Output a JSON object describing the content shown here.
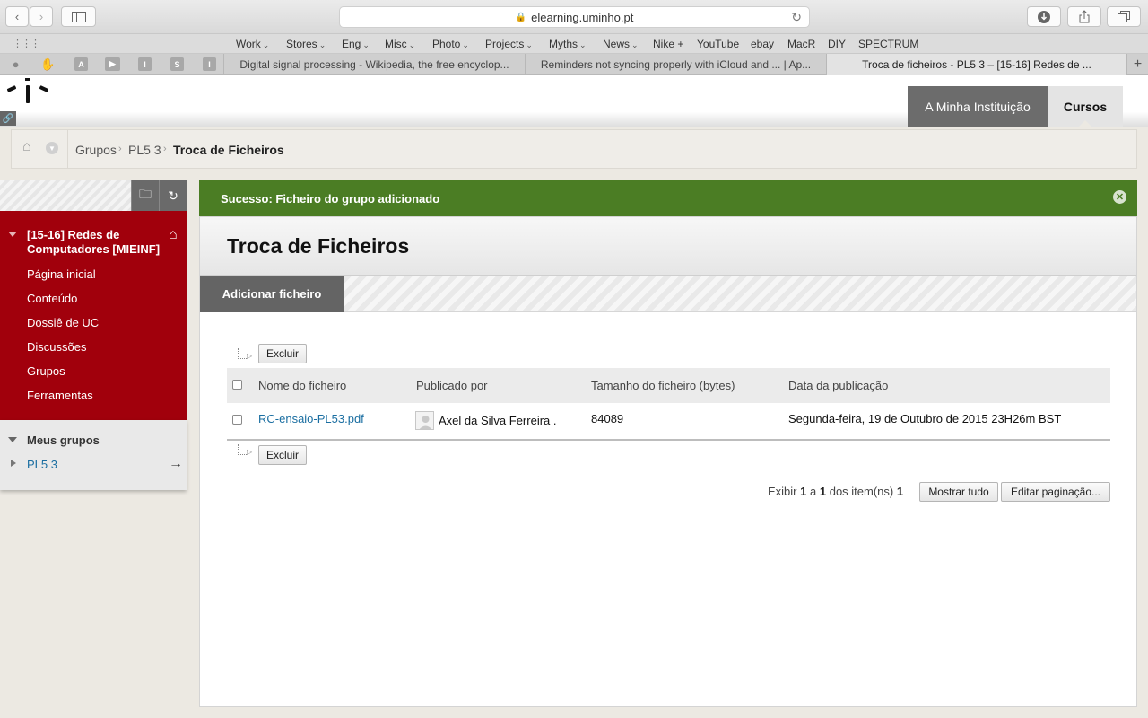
{
  "browser": {
    "url": "elearning.uminho.pt",
    "favorites": [
      {
        "label": "Work",
        "menu": true
      },
      {
        "label": "Stores",
        "menu": true
      },
      {
        "label": "Eng",
        "menu": true
      },
      {
        "label": "Misc",
        "menu": true
      },
      {
        "label": "Photo",
        "menu": true
      },
      {
        "label": "Projects",
        "menu": true
      },
      {
        "label": "Myths",
        "menu": true
      },
      {
        "label": "News",
        "menu": true
      },
      {
        "label": "Nike +",
        "menu": false
      },
      {
        "label": "YouTube",
        "menu": false
      },
      {
        "label": "ebay",
        "menu": false
      },
      {
        "label": "MacR",
        "menu": false
      },
      {
        "label": "DIY",
        "menu": false
      },
      {
        "label": "SPECTRUM",
        "menu": false
      }
    ],
    "pinned_tabs": [
      "A",
      "I",
      "S",
      "I"
    ],
    "tabs": [
      {
        "title": "Digital signal processing - Wikipedia, the free encyclop..."
      },
      {
        "title": "Reminders not syncing properly with iCloud and ... | Ap..."
      },
      {
        "title": "Troca de ficheiros - PL5 3 – [15-16] Redes de ..."
      }
    ]
  },
  "header": {
    "nav": [
      "A Minha Instituição",
      "Cursos"
    ]
  },
  "breadcrumb": [
    "Grupos",
    "PL5 3",
    "Troca de Ficheiros"
  ],
  "course_menu": {
    "course_title": "[15-16] Redes de Computadores [MIEINF]",
    "items": [
      "Página inicial",
      "Conteúdo",
      "Dossiê de UC",
      "Discussões",
      "Grupos",
      "Ferramentas"
    ],
    "my_groups_title": "Meus grupos",
    "my_groups": [
      "PL5 3"
    ]
  },
  "receipt": {
    "message": "Sucesso: Ficheiro do grupo adicionado"
  },
  "page": {
    "title": "Troca de Ficheiros",
    "add_file_label": "Adicionar ficheiro",
    "delete_label": "Excluir",
    "columns": [
      "Nome do ficheiro",
      "Publicado por",
      "Tamanho do ficheiro (bytes)",
      "Data da publicação"
    ],
    "rows": [
      {
        "file": "RC-ensaio-PL53.pdf",
        "published_by": "Axel da Silva Ferreira .",
        "size": "84089",
        "date": "Segunda-feira, 19 de Outubro de 2015 23H26m BST"
      }
    ],
    "pager": {
      "prefix": "Exibir",
      "from": "1",
      "sep": "a",
      "to": "1",
      "middle": "dos item(ns)",
      "total": "1",
      "show_all_label": "Mostrar tudo",
      "edit_paging_label": "Editar paginação..."
    }
  },
  "colors": {
    "course_menu_bg": "#a1000c",
    "receipt_bg": "#4b7d24",
    "link": "#1a6ea1",
    "nav_active": "#6c6c6c"
  }
}
